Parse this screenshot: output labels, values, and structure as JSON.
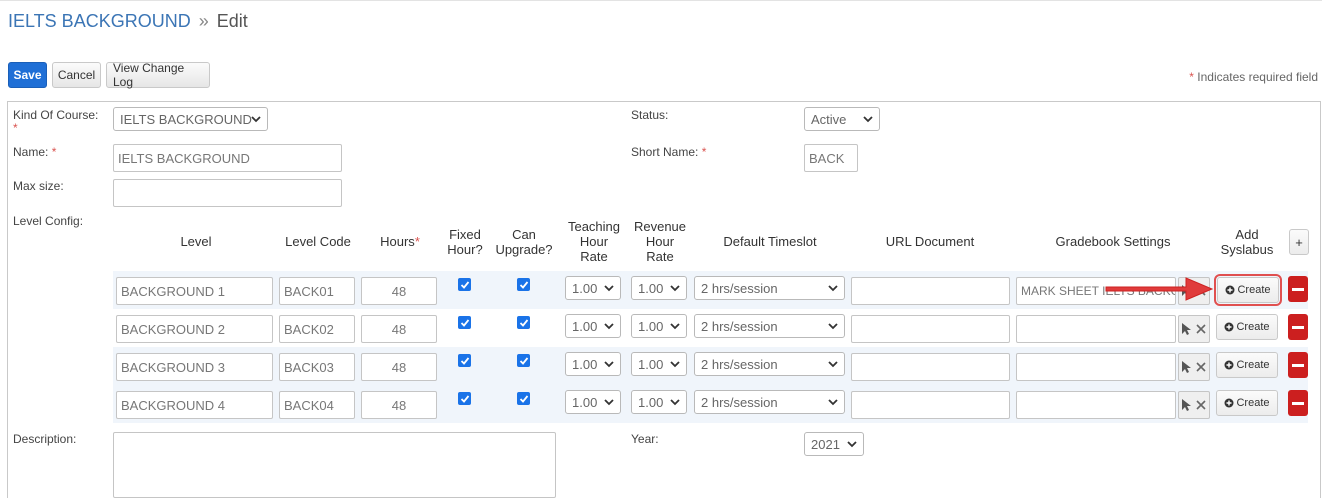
{
  "breadcrumb": {
    "parent": "IELTS BACKGROUND",
    "separator": "»",
    "current": "Edit"
  },
  "toolbar": {
    "save_label": "Save",
    "cancel_label": "Cancel",
    "changelog_label": "View Change Log"
  },
  "required_note": {
    "star": "*",
    "text": " Indicates required field"
  },
  "form": {
    "kind_label": "Kind Of Course:",
    "kind_value": "IELTS BACKGROUND",
    "name_label": "Name:",
    "name_value": "IELTS BACKGROUND",
    "maxsize_label": "Max size:",
    "maxsize_value": "",
    "status_label": "Status:",
    "status_value": "Active",
    "shortname_label": "Short Name:",
    "shortname_value": "BACK",
    "levelconfig_label": "Level Config:",
    "description_label": "Description:",
    "description_value": "",
    "year_label": "Year:",
    "year_value": "2021",
    "required_star": "*"
  },
  "level_table": {
    "headers": {
      "level": "Level",
      "level_code": "Level Code",
      "hours": "Hours",
      "hours_star": "*",
      "fixed_hour_1": "Fixed",
      "fixed_hour_2": "Hour?",
      "can_upgrade_1": "Can",
      "can_upgrade_2": "Upgrade?",
      "teaching_1": "Teaching",
      "teaching_2": "Hour",
      "teaching_3": "Rate",
      "revenue_1": "Revenue",
      "revenue_2": "Hour",
      "revenue_3": "Rate",
      "timeslot": "Default Timeslot",
      "url_doc": "URL Document",
      "gradebook": "Gradebook Settings",
      "syllabus_1": "Add",
      "syllabus_2": "Syslabus",
      "add_row": "+"
    },
    "create_label": "Create",
    "rows": [
      {
        "level": "BACKGROUND 1",
        "code": "BACK01",
        "hours": "48",
        "fixed": true,
        "upgrade": true,
        "teaching": "1.00",
        "revenue": "1.00",
        "timeslot": "2 hrs/session",
        "url": "",
        "gradebook": "MARK SHEET IELTS BACKGROUND"
      },
      {
        "level": "BACKGROUND 2",
        "code": "BACK02",
        "hours": "48",
        "fixed": true,
        "upgrade": true,
        "teaching": "1.00",
        "revenue": "1.00",
        "timeslot": "2 hrs/session",
        "url": "",
        "gradebook": ""
      },
      {
        "level": "BACKGROUND 3",
        "code": "BACK03",
        "hours": "48",
        "fixed": true,
        "upgrade": true,
        "teaching": "1.00",
        "revenue": "1.00",
        "timeslot": "2 hrs/session",
        "url": "",
        "gradebook": ""
      },
      {
        "level": "BACKGROUND 4",
        "code": "BACK04",
        "hours": "48",
        "fixed": true,
        "upgrade": true,
        "teaching": "1.00",
        "revenue": "1.00",
        "timeslot": "2 hrs/session",
        "url": "",
        "gradebook": ""
      }
    ]
  },
  "colors": {
    "link": "#3b75b5",
    "primary": "#1f6fd6",
    "danger": "#cc1f1f",
    "annotation_arrow": "#e03b3b"
  }
}
